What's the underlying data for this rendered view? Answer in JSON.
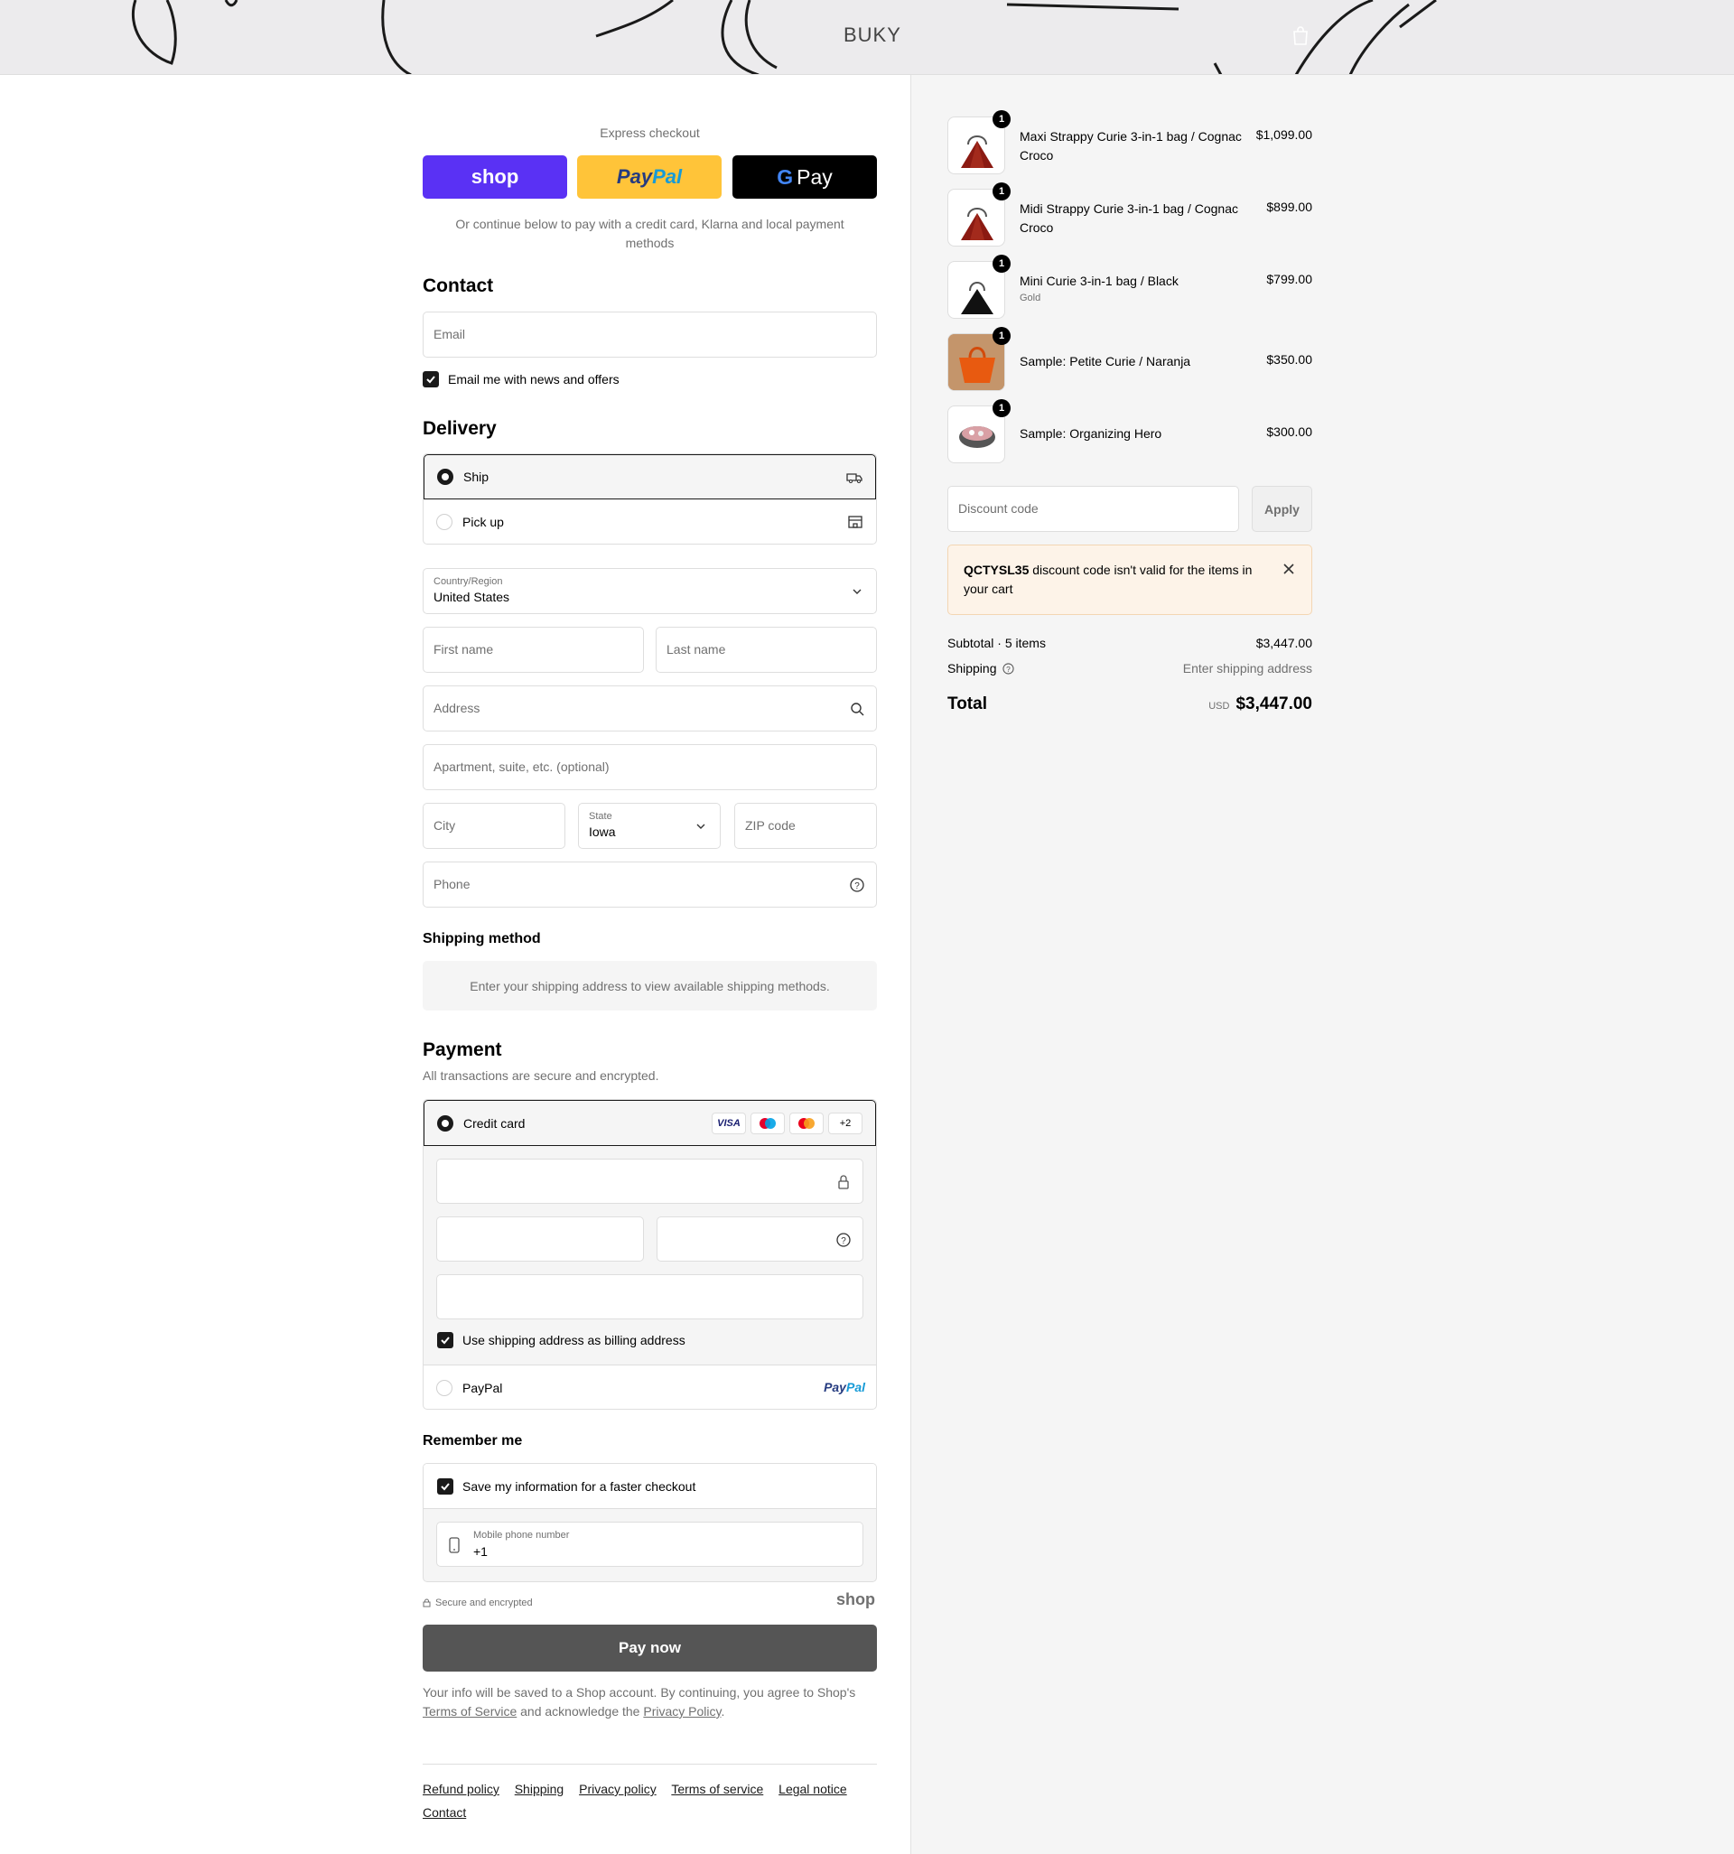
{
  "header": {
    "logo": "BUKY",
    "cart_icon": "bag-icon"
  },
  "express": {
    "label": "Express checkout",
    "shop": "shop",
    "paypal": "PayPal",
    "gpay": "Pay",
    "or_text": "Or continue below to pay with a credit card, Klarna and local payment methods"
  },
  "contact": {
    "title": "Contact",
    "email_placeholder": "Email",
    "news_label": "Email me with news and offers"
  },
  "delivery": {
    "title": "Delivery",
    "ship": "Ship",
    "pickup": "Pick up",
    "country_label": "Country/Region",
    "country_value": "United States",
    "first_name": "First name",
    "last_name": "Last name",
    "address": "Address",
    "apartment": "Apartment, suite, etc. (optional)",
    "city": "City",
    "state_label": "State",
    "state_value": "Iowa",
    "zip": "ZIP code",
    "phone": "Phone"
  },
  "shipping_method": {
    "title": "Shipping method",
    "message": "Enter your shipping address to view available shipping methods."
  },
  "payment": {
    "title": "Payment",
    "subtitle": "All transactions are secure and encrypted.",
    "credit_card": "Credit card",
    "badges": [
      "VISA",
      "+2"
    ],
    "billing_label": "Use shipping address as billing address",
    "paypal": "PayPal"
  },
  "remember": {
    "title": "Remember me",
    "save_label": "Save my information for a faster checkout",
    "mobile_label": "Mobile phone number",
    "mobile_value": "+1",
    "secure": "Secure and encrypted",
    "shop": "shop"
  },
  "paynow": "Pay now",
  "legal": {
    "text1": "Your info will be saved to a Shop account. By continuing, you agree to Shop's",
    "tos": "Terms of Service",
    "text2": " and acknowledge the ",
    "privacy": "Privacy Policy",
    "end": "."
  },
  "footer_links": [
    "Refund policy",
    "Shipping",
    "Privacy policy",
    "Terms of service",
    "Legal notice",
    "Contact"
  ],
  "cart": {
    "items": [
      {
        "name": "Maxi Strappy Curie 3-in-1 bag / Cognac Croco",
        "variant": "",
        "price": "$1,099.00",
        "qty": "1"
      },
      {
        "name": "Midi Strappy Curie 3-in-1 bag / Cognac Croco",
        "variant": "",
        "price": "$899.00",
        "qty": "1"
      },
      {
        "name": "Mini Curie 3-in-1 bag / Black",
        "variant": "Gold",
        "price": "$799.00",
        "qty": "1"
      },
      {
        "name": "Sample: Petite Curie / Naranja",
        "variant": "",
        "price": "$350.00",
        "qty": "1"
      },
      {
        "name": "Sample: Organizing Hero",
        "variant": "",
        "price": "$300.00",
        "qty": "1"
      }
    ],
    "discount_placeholder": "Discount code",
    "apply": "Apply",
    "alert_code": "QCTYSL35",
    "alert_text": " discount code isn't valid for the items in your cart",
    "subtotal_label": "Subtotal · 5 items",
    "subtotal": "$3,447.00",
    "shipping_label": "Shipping",
    "shipping_value": "Enter shipping address",
    "total_label": "Total",
    "currency": "USD",
    "total": "$3,447.00"
  }
}
